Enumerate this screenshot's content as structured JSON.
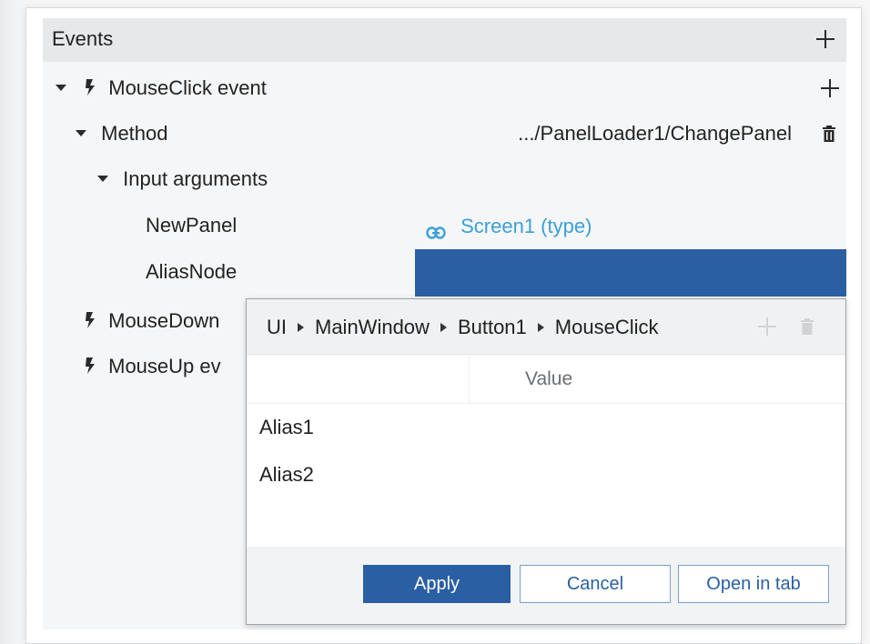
{
  "events": {
    "title": "Events",
    "add_icon": "plus-icon",
    "items": [
      {
        "label": "MouseClick event",
        "icon": "lightning-bolt-icon",
        "expanded": true
      },
      {
        "label": "MouseDown",
        "icon": "lightning-bolt-icon"
      },
      {
        "label": "MouseUp ev",
        "icon": "lightning-bolt-icon"
      }
    ],
    "method": {
      "label": "Method",
      "value": ".../PanelLoader1/ChangePanel",
      "delete_icon": "trash-icon"
    },
    "input_arguments": {
      "label": "Input arguments",
      "args": [
        {
          "name": "NewPanel",
          "value": "Screen1 (type)",
          "icon": "link-icon"
        },
        {
          "name": "AliasNode",
          "value": ""
        }
      ]
    }
  },
  "popup": {
    "breadcrumb": [
      "UI",
      "MainWindow",
      "Button1",
      "MouseClick"
    ],
    "value_column": "Value",
    "aliases": [
      "Alias1",
      "Alias2"
    ],
    "buttons": {
      "apply": "Apply",
      "cancel": "Cancel",
      "open_in_tab": "Open in tab"
    }
  },
  "colors": {
    "accent": "#2a5fa3",
    "link": "#3aa0d8",
    "panel_bg": "#f5f6f7",
    "header_bg": "#e6e8ea"
  }
}
